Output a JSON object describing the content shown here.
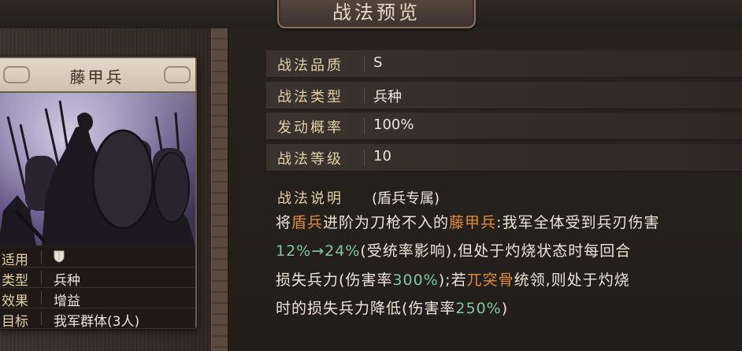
{
  "window": {
    "title": "战法预览"
  },
  "card": {
    "name": "藤甲兵",
    "attributes": [
      {
        "label": "适用",
        "value": "",
        "icon": "shield-icon"
      },
      {
        "label": "类型",
        "value": "兵种"
      },
      {
        "label": "效果",
        "value": "增益"
      },
      {
        "label": "目标",
        "value": "我军群体(3人)"
      }
    ]
  },
  "info": {
    "rows": [
      {
        "label": "战法品质",
        "value": "S"
      },
      {
        "label": "战法类型",
        "value": "兵种"
      },
      {
        "label": "发动概率",
        "value": "100%"
      },
      {
        "label": "战法等级",
        "value": "10"
      }
    ]
  },
  "description": {
    "heading": "战法说明",
    "tag": "(盾兵专属)",
    "line1": {
      "a": "将",
      "b": "盾兵",
      "c": "进阶为刀枪不入的",
      "d": "藤甲兵",
      "e": ":我军全体受到兵刃伤害"
    },
    "line2": {
      "a": "12%→24%",
      "b": "(受统率影响),但处于灼烧状态时每回合"
    },
    "line3": {
      "a": "损失兵力(伤害率",
      "b": "300%",
      "c": ");若",
      "d": "兀突骨",
      "e": "统领,则处于灼烧"
    },
    "line4": {
      "a": "时的损失兵力降低(伤害率",
      "b": "250%",
      "c": ")"
    }
  },
  "colors": {
    "label": "#e6cfa8",
    "value": "#ece4d8",
    "highlight_orange": "#e08a3c",
    "highlight_green": "#7fc99a"
  }
}
